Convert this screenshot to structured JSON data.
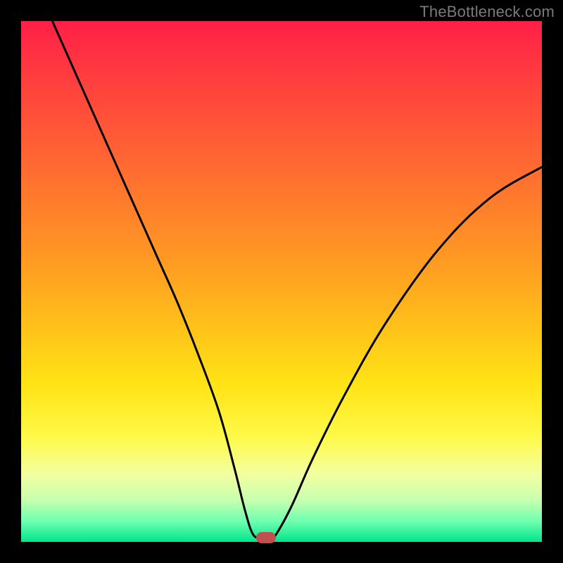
{
  "watermark": "TheBottleneck.com",
  "colors": {
    "curve": "#000000",
    "marker": "#c0504d",
    "frame": "#000000"
  },
  "chart_data": {
    "type": "line",
    "title": "",
    "xlabel": "",
    "ylabel": "",
    "xlim": [
      0,
      100
    ],
    "ylim": [
      0,
      100
    ],
    "grid": false,
    "legend": false,
    "series": [
      {
        "name": "bottleneck-curve",
        "x": [
          6,
          10,
          14,
          18,
          22,
          26,
          30,
          34,
          38,
          41,
          43,
          44.5,
          46,
          48,
          49,
          52,
          56,
          62,
          70,
          80,
          90,
          100
        ],
        "values": [
          100,
          91,
          82,
          73,
          64,
          55,
          46,
          36,
          25,
          14,
          6,
          1.5,
          0.8,
          0.8,
          1.5,
          7,
          16,
          28,
          42,
          56,
          66,
          72
        ]
      }
    ],
    "marker": {
      "x": 47,
      "y": 0.8
    },
    "gradient_stops": [
      {
        "pos": 0,
        "color": "#ff1f47"
      },
      {
        "pos": 10,
        "color": "#ff3b3f"
      },
      {
        "pos": 22,
        "color": "#ff5a36"
      },
      {
        "pos": 34,
        "color": "#ff7a2c"
      },
      {
        "pos": 46,
        "color": "#ff9a22"
      },
      {
        "pos": 58,
        "color": "#ffbf1a"
      },
      {
        "pos": 70,
        "color": "#ffe416"
      },
      {
        "pos": 80,
        "color": "#fff94a"
      },
      {
        "pos": 87,
        "color": "#f3ffa0"
      },
      {
        "pos": 92,
        "color": "#c7ffb0"
      },
      {
        "pos": 96,
        "color": "#6fffb0"
      },
      {
        "pos": 100,
        "color": "#00e58a"
      }
    ]
  }
}
